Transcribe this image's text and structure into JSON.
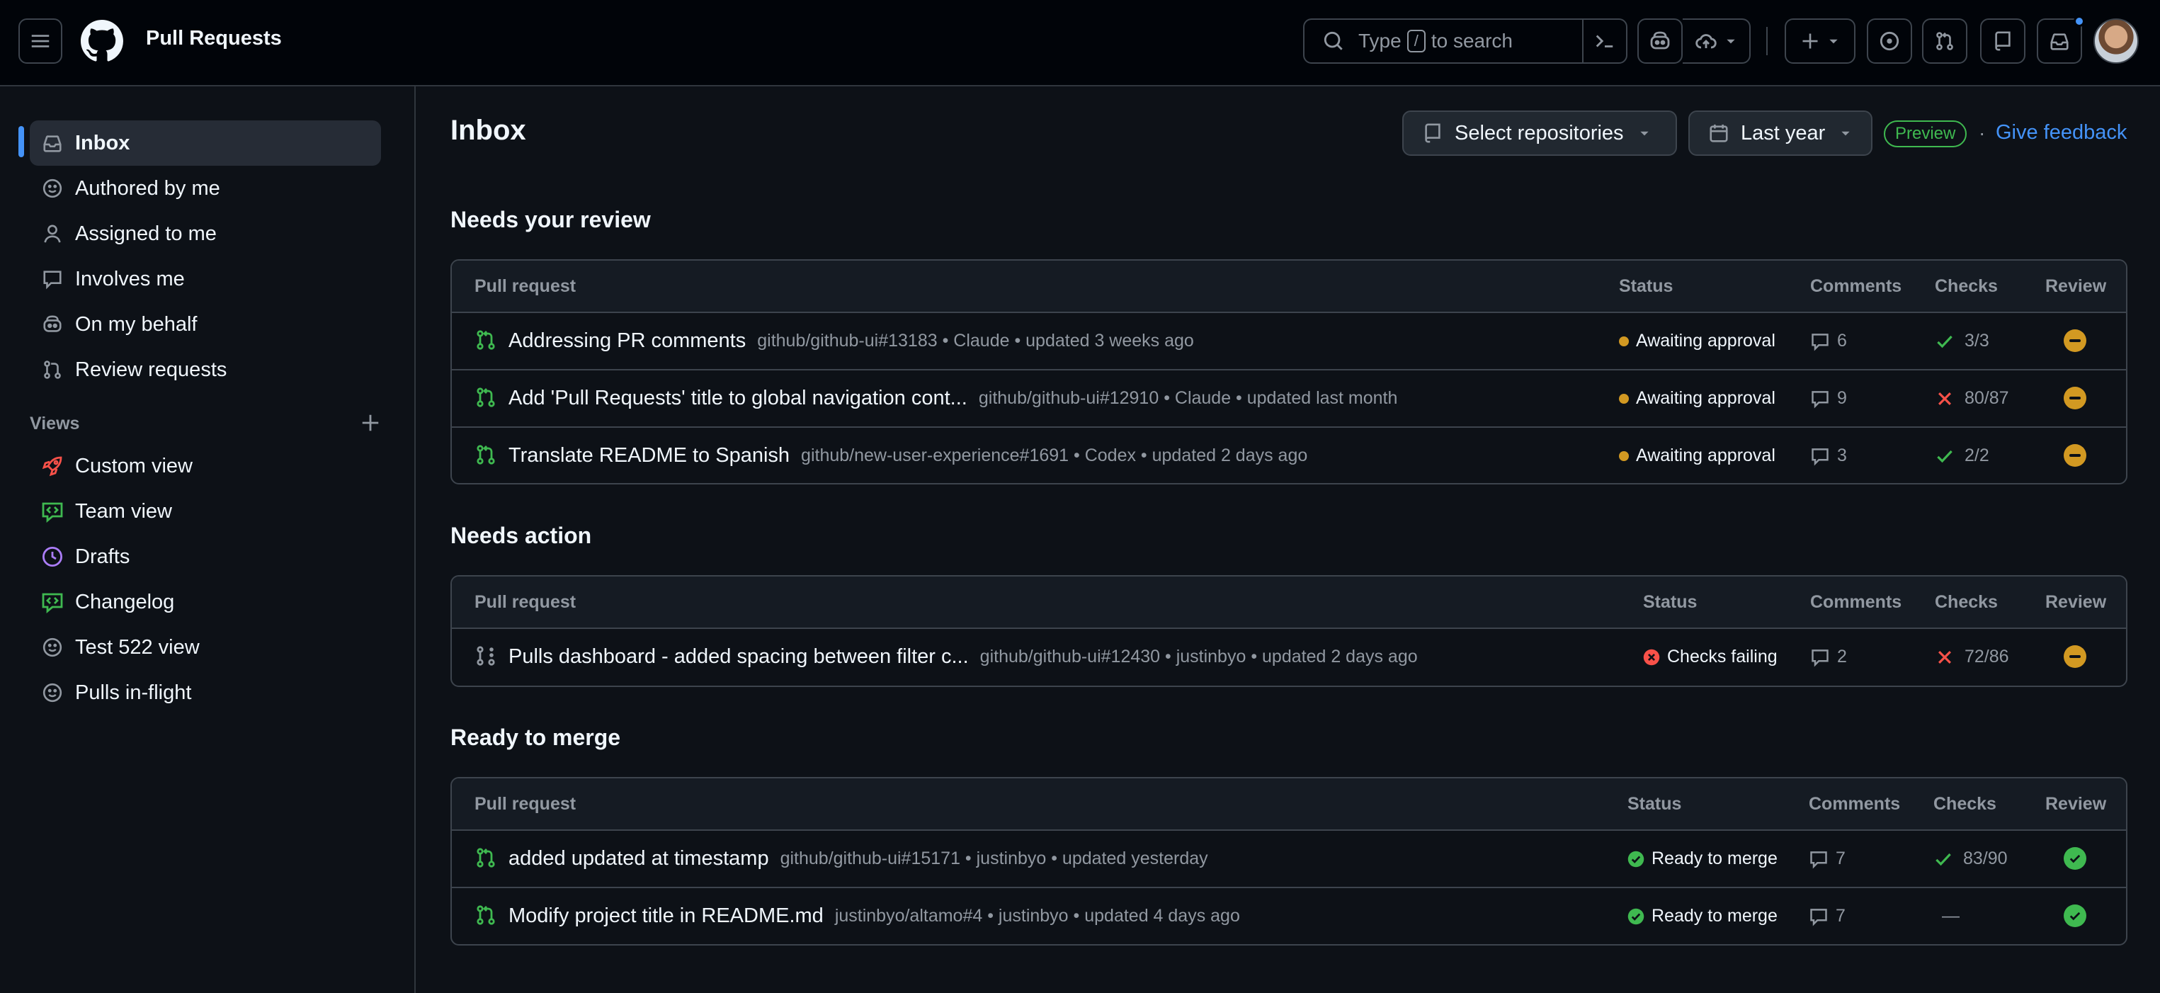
{
  "header": {
    "app_title": "Pull Requests",
    "search": {
      "prefix": "Type",
      "key": "/",
      "suffix": "to search"
    }
  },
  "sidebar": {
    "items": [
      {
        "label": "Inbox",
        "icon": "inbox-icon",
        "active": true
      },
      {
        "label": "Authored by me",
        "icon": "smiley-icon"
      },
      {
        "label": "Assigned to me",
        "icon": "person-icon"
      },
      {
        "label": "Involves me",
        "icon": "comment-icon"
      },
      {
        "label": "On my behalf",
        "icon": "copilot-icon"
      },
      {
        "label": "Review requests",
        "icon": "git-compare-icon"
      }
    ],
    "views_label": "Views",
    "views": [
      {
        "label": "Custom view",
        "icon": "rocket-icon",
        "color": "#f85149"
      },
      {
        "label": "Team view",
        "icon": "code-review-icon",
        "color": "#3fb950"
      },
      {
        "label": "Drafts",
        "icon": "clock-icon",
        "color": "#ab7df8"
      },
      {
        "label": "Changelog",
        "icon": "code-review-icon",
        "color": "#3fb950"
      },
      {
        "label": "Test 522 view",
        "icon": "smiley-icon",
        "color": "#9198a1"
      },
      {
        "label": "Pulls in-flight",
        "icon": "smiley-icon",
        "color": "#9198a1"
      }
    ]
  },
  "main": {
    "title": "Inbox",
    "filters": {
      "repos": "Select repositories",
      "range": "Last year"
    },
    "preview_badge": "Preview",
    "separator": "·",
    "feedback": "Give feedback",
    "columns": {
      "pr": "Pull request",
      "status": "Status",
      "comments": "Comments",
      "checks": "Checks",
      "review": "Review"
    },
    "sections": [
      {
        "title": "Needs your review",
        "rows": [
          {
            "title": "Addressing PR comments",
            "meta": "github/github-ui#13183 • Claude • updated 3 weeks ago",
            "status": "Awaiting approval",
            "comments": "6",
            "checks": "3/3",
            "checks_state": "pass",
            "review": "pending"
          },
          {
            "title": "Add 'Pull Requests' title to global navigation cont...",
            "meta": "github/github-ui#12910 • Claude • updated last month",
            "status": "Awaiting approval",
            "comments": "9",
            "checks": "80/87",
            "checks_state": "fail",
            "review": "pending"
          },
          {
            "title": "Translate README to Spanish",
            "meta": "github/new-user-experience#1691 • Codex • updated 2 days ago",
            "status": "Awaiting approval",
            "comments": "3",
            "checks": "2/2",
            "checks_state": "pass",
            "review": "pending"
          }
        ]
      },
      {
        "title": "Needs action",
        "rows": [
          {
            "title": "Pulls dashboard - added spacing between filter c...",
            "meta": "github/github-ui#12430 • justinbyo • updated 2 days ago",
            "status": "Checks failing",
            "comments": "2",
            "checks": "72/86",
            "checks_state": "fail",
            "review": "pending"
          }
        ]
      },
      {
        "title": "Ready to merge",
        "rows": [
          {
            "title": "added updated at timestamp",
            "meta": "github/github-ui#15171 • justinbyo • updated yesterday",
            "status": "Ready to merge",
            "comments": "7",
            "checks": "83/90",
            "checks_state": "pass",
            "review": "approved"
          },
          {
            "title": "Modify project title in README.md",
            "meta": "justinbyo/altamo#4 • justinbyo • updated 4 days ago",
            "status": "Ready to merge",
            "comments": "7",
            "checks": "—",
            "checks_state": "none",
            "review": "approved"
          }
        ]
      }
    ]
  },
  "colors": {
    "bg": "#0d1117",
    "accent": "#4493f8",
    "success": "#3fb950",
    "attention": "#d29922",
    "danger": "#f85149"
  }
}
